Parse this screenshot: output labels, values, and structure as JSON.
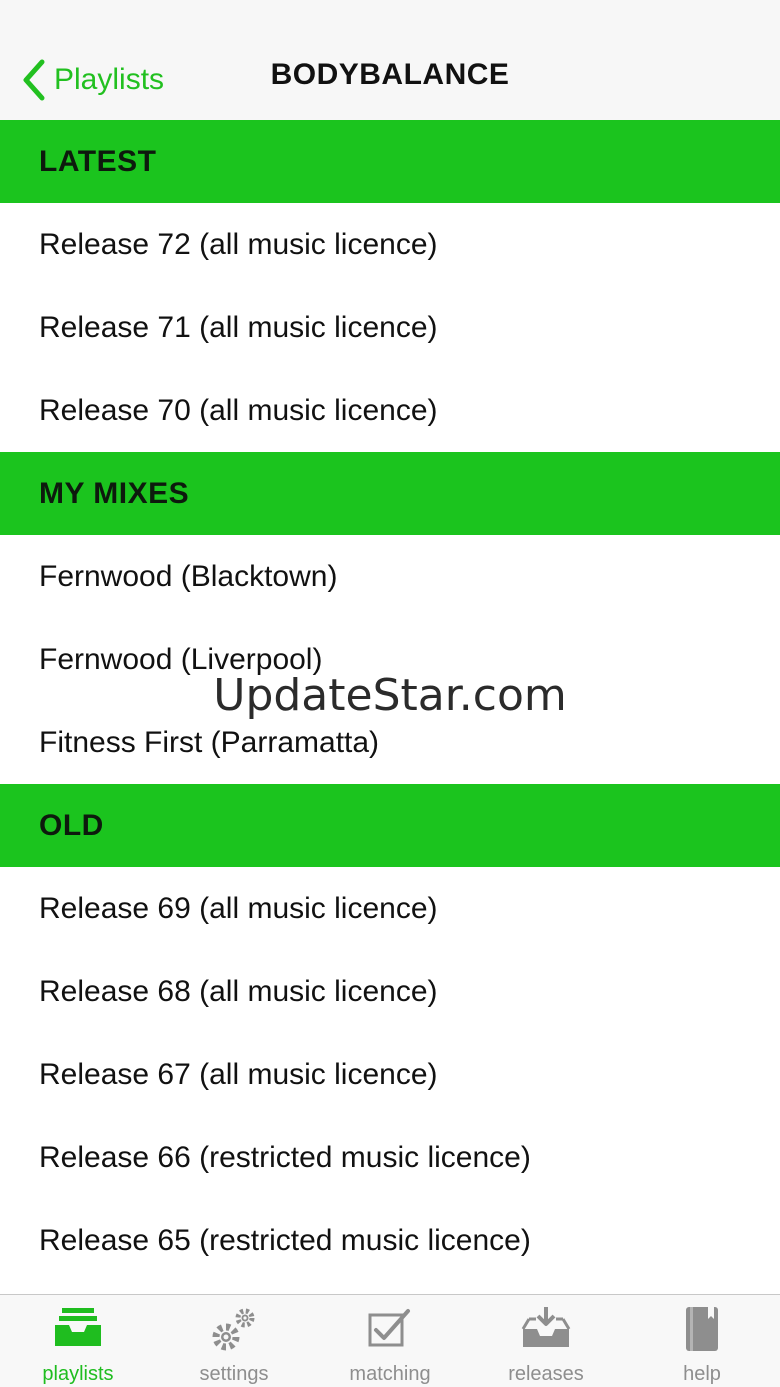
{
  "nav": {
    "back_label": "Playlists",
    "title": "BODYBALANCE"
  },
  "sections": [
    {
      "header": "LATEST",
      "items": [
        "Release 72 (all music licence)",
        "Release 71 (all music licence)",
        "Release 70 (all music licence)"
      ]
    },
    {
      "header": "MY MIXES",
      "items": [
        "Fernwood (Blacktown)",
        "Fernwood (Liverpool)",
        "Fitness First (Parramatta)"
      ]
    },
    {
      "header": "OLD",
      "items": [
        "Release 69 (all music licence)",
        "Release 68 (all music licence)",
        "Release 67 (all music licence)",
        "Release 66 (restricted music licence)",
        "Release 65 (restricted music licence)"
      ]
    }
  ],
  "watermark": "UpdateStar.com",
  "tabs": [
    {
      "label": "playlists",
      "icon": "inbox-tray-icon",
      "active": true
    },
    {
      "label": "settings",
      "icon": "gears-icon",
      "active": false
    },
    {
      "label": "matching",
      "icon": "checkbox-pen-icon",
      "active": false
    },
    {
      "label": "releases",
      "icon": "download-tray-icon",
      "active": false
    },
    {
      "label": "help",
      "icon": "book-icon",
      "active": false
    }
  ],
  "colors": {
    "accent": "#1bc41e",
    "tab_active": "#1fbd1f",
    "tab_inactive": "#8e8e8e"
  }
}
